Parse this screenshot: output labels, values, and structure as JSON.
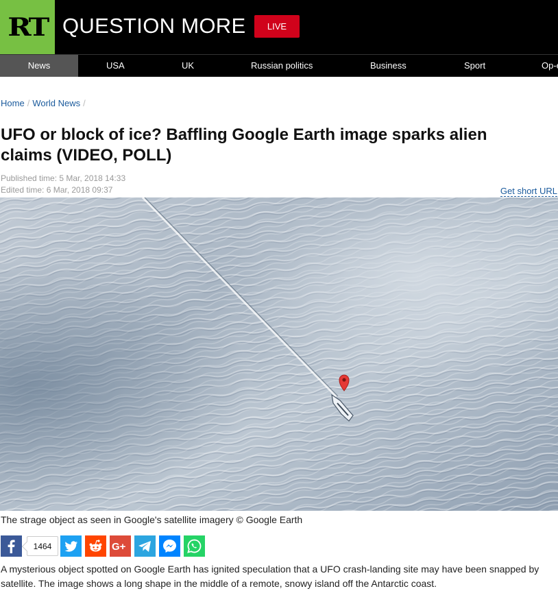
{
  "header": {
    "logo_text": "RT",
    "slogan": "QUESTION MORE",
    "live_label": "LIVE"
  },
  "nav": {
    "items": [
      {
        "label": "News",
        "active": true
      },
      {
        "label": "USA"
      },
      {
        "label": "UK"
      },
      {
        "label": "Russian politics"
      },
      {
        "label": "Business"
      },
      {
        "label": "Sport"
      },
      {
        "label": "Op-e"
      }
    ]
  },
  "breadcrumb": {
    "items": [
      "Home",
      "World News"
    ],
    "separator": "/"
  },
  "article": {
    "title": "UFO or block of ice? Baffling Google Earth image sparks alien claims (VIDEO, POLL)",
    "published": "Published time: 5 Mar, 2018 14:33",
    "edited": "Edited time: 6 Mar, 2018 09:37",
    "short_url_label": "Get short URL",
    "image_caption": "The strage object as seen in Google's satellite imagery © Google Earth",
    "share_count": "1464",
    "body": "A mysterious object spotted on Google Earth has ignited speculation that a UFO crash-landing site may have been snapped by satellite. The image shows a long shape in the middle of a remote, snowy island off the Antarctic coast."
  },
  "share_buttons": [
    {
      "name": "facebook-icon",
      "color": "#3b5998"
    },
    {
      "name": "twitter-icon",
      "color": "#1da1f2"
    },
    {
      "name": "reddit-icon",
      "color": "#ff4500"
    },
    {
      "name": "google-plus-icon",
      "color": "#dd4b39"
    },
    {
      "name": "telegram-icon",
      "color": "#2ca5e0"
    },
    {
      "name": "messenger-icon",
      "color": "#0084ff"
    },
    {
      "name": "whatsapp-icon",
      "color": "#25d366"
    }
  ],
  "colors": {
    "brand_green": "#77c043",
    "live_red": "#d0021b",
    "link_blue": "#1a5a9c"
  }
}
